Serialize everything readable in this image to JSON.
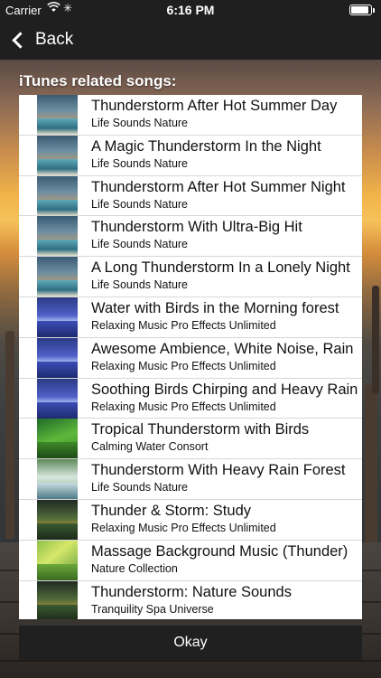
{
  "status_bar": {
    "carrier": "Carrier",
    "wifi_icon": "wifi-icon",
    "activity_icon": "activity-spinner-icon",
    "time": "6:16 PM",
    "battery_icon": "battery-icon"
  },
  "nav": {
    "back_label": "Back",
    "back_icon": "chevron-left-icon"
  },
  "heading": "iTunes related songs:",
  "songs": [
    {
      "title": "Thunderstorm After Hot Summer Day",
      "artist": "Life Sounds Nature",
      "art": "ocean"
    },
    {
      "title": "A Magic Thunderstorm In the Night",
      "artist": "Life Sounds Nature",
      "art": "ocean"
    },
    {
      "title": "Thunderstorm After Hot Summer Night",
      "artist": "Life Sounds Nature",
      "art": "ocean"
    },
    {
      "title": "Thunderstorm With Ultra-Big Hit",
      "artist": "Life Sounds Nature",
      "art": "ocean"
    },
    {
      "title": "A Long Thunderstorm In a Lonely Night",
      "artist": "Life Sounds Nature",
      "art": "ocean"
    },
    {
      "title": "Water with Birds in the Morning forest",
      "artist": "Relaxing Music Pro Effects Unlimited",
      "art": "storm"
    },
    {
      "title": "Awesome Ambience, White Noise, Rain",
      "artist": "Relaxing Music Pro Effects Unlimited",
      "art": "storm"
    },
    {
      "title": "Soothing Birds Chirping and Heavy Rain",
      "artist": "Relaxing Music Pro Effects Unlimited",
      "art": "storm"
    },
    {
      "title": "Tropical Thunderstorm with Birds",
      "artist": "Calming Water Consort",
      "art": "green"
    },
    {
      "title": "Thunderstorm With Heavy Rain Forest",
      "artist": "Life Sounds Nature",
      "art": "waterfall"
    },
    {
      "title": "Thunder & Storm: Study",
      "artist": "Relaxing Music Pro Effects Unlimited",
      "art": "nature"
    },
    {
      "title": "Massage Background Music (Thunder)",
      "artist": "Nature Collection",
      "art": "leaf"
    },
    {
      "title": "Thunderstorm: Nature Sounds",
      "artist": "Tranquility Spa Universe",
      "art": "nature"
    }
  ],
  "okay_label": "Okay",
  "colors": {
    "nav_bg": "#1f1f1f",
    "list_bg": "#ffffff",
    "button_bg": "#202020",
    "text": "#111111"
  }
}
